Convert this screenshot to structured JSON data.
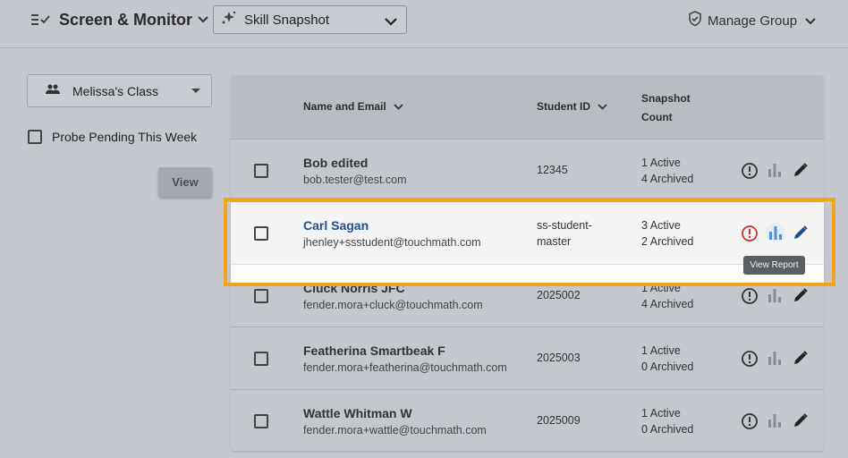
{
  "header": {
    "app_title": "Screen & Monitor",
    "snapshot_select": "Skill Snapshot",
    "manage_group": "Manage Group"
  },
  "sidebar": {
    "class_select": "Melissa's Class",
    "probe_pending_label": "Probe Pending This Week",
    "view_button": "View"
  },
  "table": {
    "columns": {
      "name": "Name and Email",
      "student_id": "Student ID",
      "snapshot_line1": "Snapshot",
      "snapshot_line2": "Count"
    },
    "rows": [
      {
        "name": "Bob edited",
        "email": "bob.tester@test.com",
        "student_id": "12345",
        "student_id_line2": "",
        "active": "1 Active",
        "archived": "4 Archived"
      },
      {
        "name": "Carl Sagan",
        "email": "jhenley+ssstudent@touchmath.com",
        "student_id": "ss-student-",
        "student_id_line2": "master",
        "active": "3 Active",
        "archived": "2 Archived"
      },
      {
        "name": "Cluck Norris JFC",
        "email": "fender.mora+cluck@touchmath.com",
        "student_id": "2025002",
        "student_id_line2": "",
        "active": "1 Active",
        "archived": "4 Archived"
      },
      {
        "name": "Featherina Smartbeak F",
        "email": "fender.mora+featherina@touchmath.com",
        "student_id": "2025003",
        "student_id_line2": "",
        "active": "1 Active",
        "archived": "0 Archived"
      },
      {
        "name": "Wattle Whitman W",
        "email": "fender.mora+wattle@touchmath.com",
        "student_id": "2025009",
        "student_id_line2": "",
        "active": "1 Active",
        "archived": "0 Archived"
      }
    ]
  },
  "tooltip": "View Report",
  "colors": {
    "accent_link": "#1d4f91",
    "highlight_border": "#f5a21b",
    "alert_red": "#d32f2f",
    "chart_blue": "#4a90d9"
  },
  "icons": [
    "checklist-icon",
    "chevron-down-icon",
    "sparkle-icon",
    "shield-check-icon",
    "people-icon",
    "alert-icon",
    "bar-chart-icon",
    "pencil-icon"
  ]
}
